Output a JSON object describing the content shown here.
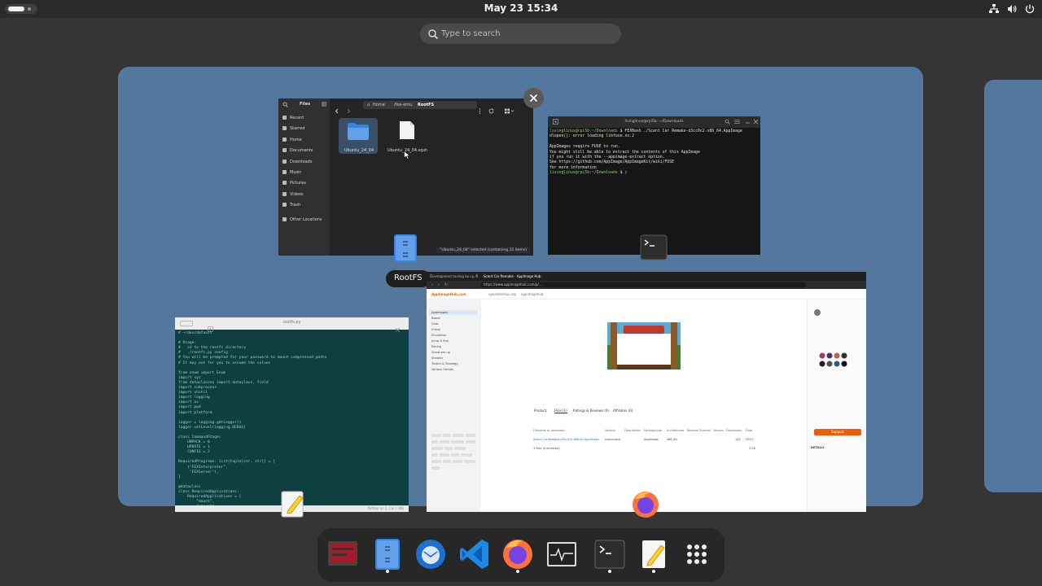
{
  "topbar": {
    "clock": "May 23  15:34",
    "tray_icons": [
      "network-icon",
      "volume-icon",
      "power-icon"
    ]
  },
  "search": {
    "placeholder": "Type to search"
  },
  "files_window": {
    "sidebar_title": "Files",
    "sidebar_items": [
      "Recent",
      "Starred",
      "Home",
      "Documents",
      "Downloads",
      "Music",
      "Pictures",
      "Videos",
      "Trash",
      "Other Locations"
    ],
    "path": [
      "Home",
      "/fex-emu",
      "RootFS"
    ],
    "items": [
      {
        "name": "Ubuntu_24_04",
        "kind": "folder"
      },
      {
        "name": "Ubuntu_24_04.sqsh",
        "kind": "file"
      }
    ],
    "status": "\"Ubuntu_24_04\" selected (containing 15 items)"
  },
  "terminal_window": {
    "title": "livinglinux@rpi5b: ~/Downloads",
    "lines": [
      {
        "prompt": "livinglinux@rpi5b:~/Downloads",
        "cmd": "$ FEXBash ./Scent Car Remake-d3cc0c2-x86_64.AppImage"
      },
      {
        "text": "dlopen(): error loading libfuse.so.2"
      },
      {
        "text": ""
      },
      {
        "text": "AppImages require FUSE to run."
      },
      {
        "text": "You might still be able to extract the contents of this AppImage"
      },
      {
        "text": "if you run it with the --appimage-extract option."
      },
      {
        "text": "See https://github.com/AppImage/AppImageKit/wiki/FUSE"
      },
      {
        "text": "for more information"
      },
      {
        "prompt": "livinglinux@rpi5b:~/Downloads",
        "cmd": "$ "
      }
    ]
  },
  "tooltip": {
    "label": "RootFS"
  },
  "editor_window": {
    "title": "rootfs.py",
    "code": [
      "# ~/dev/default",
      "",
      "# Usage:",
      "#   cd to the rootfs directory",
      "#   ./rootfs.py config",
      "# You will be prompted for your password to mount compressed paths",
      "# It may ask for you to assume the values",
      "",
      "from enum import Enum",
      "import sys",
      "from dataclasses import dataclass, field",
      "import subprocess",
      "import shutil",
      "import logging",
      "import os",
      "import pwd",
      "import platform",
      "",
      "logger = logging.getLogger()",
      "logger.setLevel(logging.DEBUG)",
      "",
      "class CommandStage(",
      "    UNPACK = 0",
      "    UPDATE = 1",
      "    CONFIG = 2",
      "",
      "RequiredPrograms: list[tuple[str, str]] = [",
      "    (\"FEXInterpreter\",",
      "     \"FEXServer\"),",
      "]",
      "",
      "@dataclass",
      "class RequiredApplications:",
      "    RequiredApplications = [",
      "        \"mount\",",
      "        \"umount\",",
      "        \"unshare\","
    ],
    "status": "Python   Ln 1, Col 1   INS"
  },
  "browser_window": {
    "tabs": [
      "Development tooling by cp /R",
      "Scent Car Remake - AppImage Hub"
    ],
    "url": "https://www.appimagehub.com/p/...",
    "site_links": [
      "AppImageHub.com",
      "opendesktop.org",
      "appimagehub"
    ],
    "categories": [
      "Appimages",
      "Board",
      "Card",
      "Chess",
      "Emulation",
      "Jump & Run",
      "Racing",
      "Shoot em up",
      "Shooter",
      "Tactics & Strategy",
      "Various Games"
    ],
    "product_tabs": [
      "Product",
      "Files (1)",
      "Ratings & Reviews (0)",
      "Affiliates (0)"
    ],
    "table_header": [
      "Filename or download",
      "Version",
      "Description",
      "Packagetype",
      "Architecture",
      "Release Channel",
      "Version",
      "Downloads",
      "Date"
    ],
    "table_row": [
      "Scent-Car-Remake-d3cc0c2-x86-64.AppImage",
      "continuous",
      "",
      "AppImage",
      "x86_64",
      "",
      "",
      "145",
      "2023-"
    ],
    "files_summary": "1 files (0 archived)",
    "files_total": "3.26",
    "support_button": "Support",
    "details_title": "DETAILS"
  },
  "dash": {
    "items": [
      {
        "name": "ubuntu-software-icon",
        "running": false
      },
      {
        "name": "files-icon",
        "running": true
      },
      {
        "name": "thunderbird-icon",
        "running": false
      },
      {
        "name": "vscode-icon",
        "running": false
      },
      {
        "name": "firefox-icon",
        "running": true
      },
      {
        "name": "system-monitor-icon",
        "running": false
      },
      {
        "name": "terminal-icon",
        "running": true
      },
      {
        "name": "text-editor-icon",
        "running": true
      },
      {
        "name": "show-apps-icon",
        "running": false
      }
    ]
  },
  "colors": {
    "workspace": "#54789d",
    "background": "#353535",
    "dash": "#272727",
    "files_accent": "#3584e4",
    "support": "#e95f0f"
  }
}
